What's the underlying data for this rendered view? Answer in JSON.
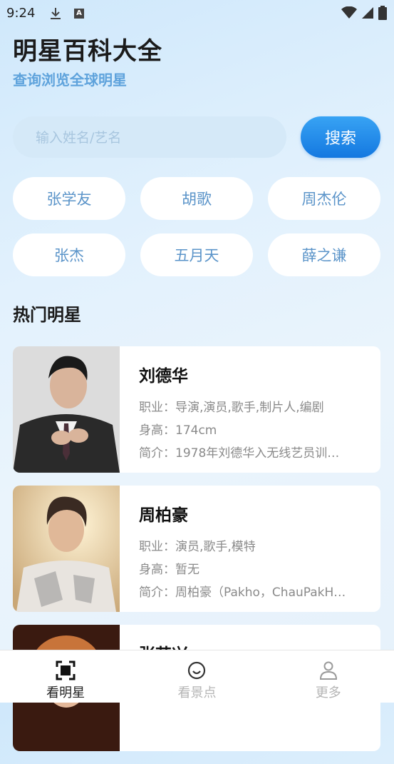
{
  "status_bar": {
    "time": "9:24"
  },
  "header": {
    "title": "明星百科大全",
    "subtitle": "查询浏览全球明星"
  },
  "search": {
    "placeholder": "输入姓名/艺名",
    "button_label": "搜索"
  },
  "quick_tags": [
    "张学友",
    "胡歌",
    "周杰伦",
    "张杰",
    "五月天",
    "薛之谦"
  ],
  "section": {
    "title": "热门明星"
  },
  "stars": [
    {
      "name": "刘德华",
      "occupation": "职业：导演,演员,歌手,制片人,编剧",
      "height": "身高：174cm",
      "intro": "简介：1978年刘德华入无线艺员训…"
    },
    {
      "name": "周柏豪",
      "occupation": "职业：演员,歌手,模特",
      "height": "身高：暂无",
      "intro": "简介：周柏豪（Pakho，ChauPakH…"
    },
    {
      "name": "张艺兴",
      "occupation": "",
      "height": "",
      "intro": ""
    }
  ],
  "nav": [
    {
      "label": "看明星",
      "icon": "scan-frame-icon",
      "active": true
    },
    {
      "label": "看景点",
      "icon": "smile-icon",
      "active": false
    },
    {
      "label": "更多",
      "icon": "person-icon",
      "active": false
    }
  ],
  "colors": {
    "accent": "#1478e0",
    "subtitle": "#5fa3dc",
    "tag_text": "#5b94c9"
  }
}
